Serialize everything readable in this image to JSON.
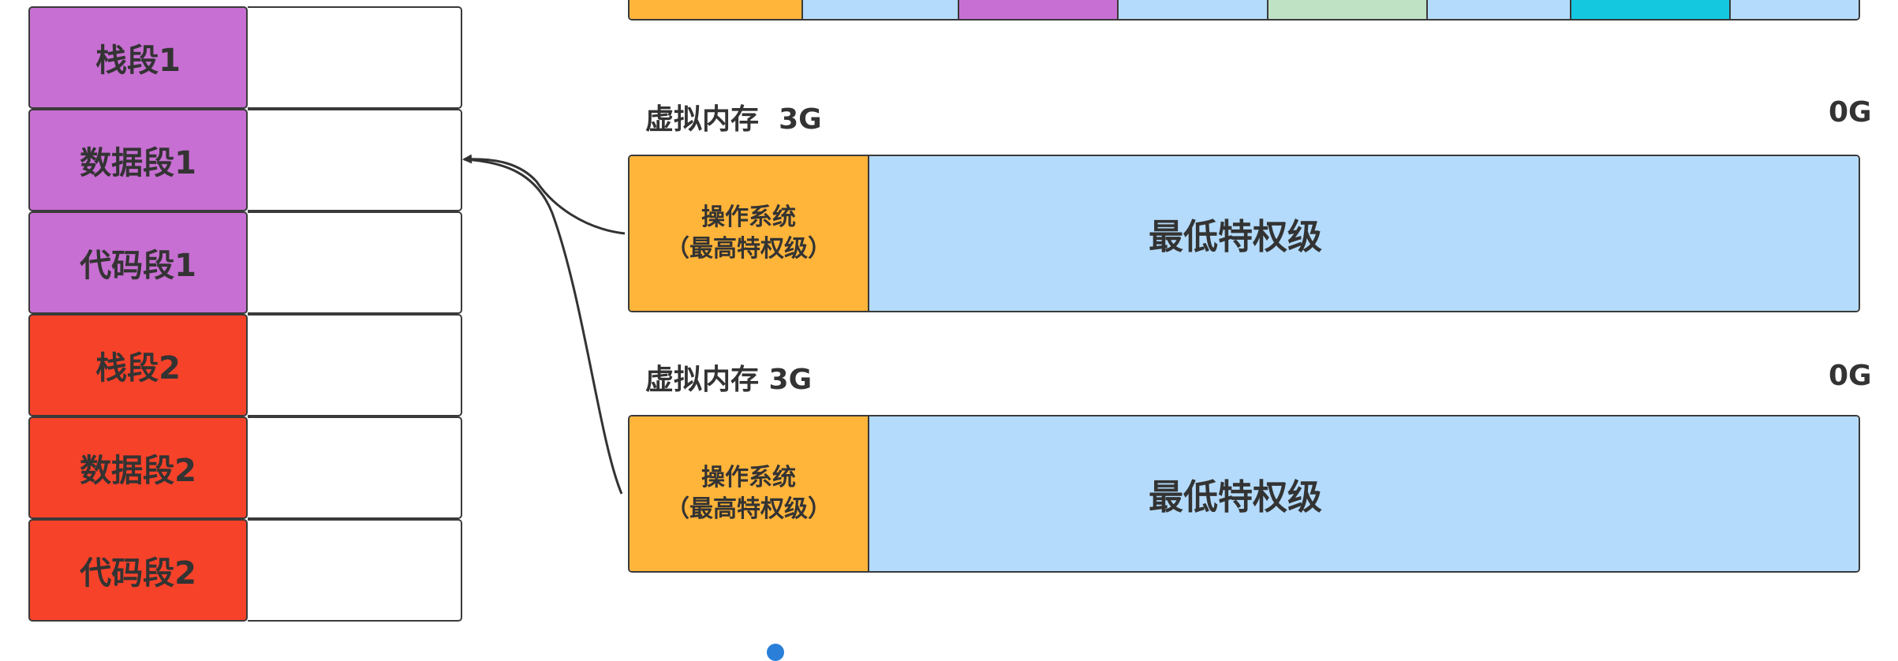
{
  "colors": {
    "process1_segment": "#c76fd2",
    "process2_segment": "#f64229",
    "os_region": "#ffb43a",
    "user_region": "#b4dbfc",
    "border": "#3a3a3a",
    "top_bar_cells": [
      "#ffb43a",
      "#b4dbfc",
      "#c76fd2",
      "#b4dbfc",
      "#bfe2c4",
      "#b4dbfc",
      "#14c8e0",
      "#b4dbfc"
    ]
  },
  "segment_table": {
    "rows": [
      {
        "name": "栈段1",
        "group": "process1"
      },
      {
        "name": "数据段1",
        "group": "process1"
      },
      {
        "name": "代码段1",
        "group": "process1"
      },
      {
        "name": "栈段2",
        "group": "process2"
      },
      {
        "name": "数据段2",
        "group": "process2"
      },
      {
        "name": "代码段2",
        "group": "process2"
      }
    ]
  },
  "virtual_memory": [
    {
      "label": "虚拟内存  3G",
      "end_label": "0G",
      "os_line1": "操作系统",
      "os_line2": "（最高特权级）",
      "user_label": "最低特权级"
    },
    {
      "label": "虚拟内存 3G",
      "end_label": "0G",
      "os_line1": "操作系统",
      "os_line2": "（最高特权级）",
      "user_label": "最低特权级"
    }
  ]
}
